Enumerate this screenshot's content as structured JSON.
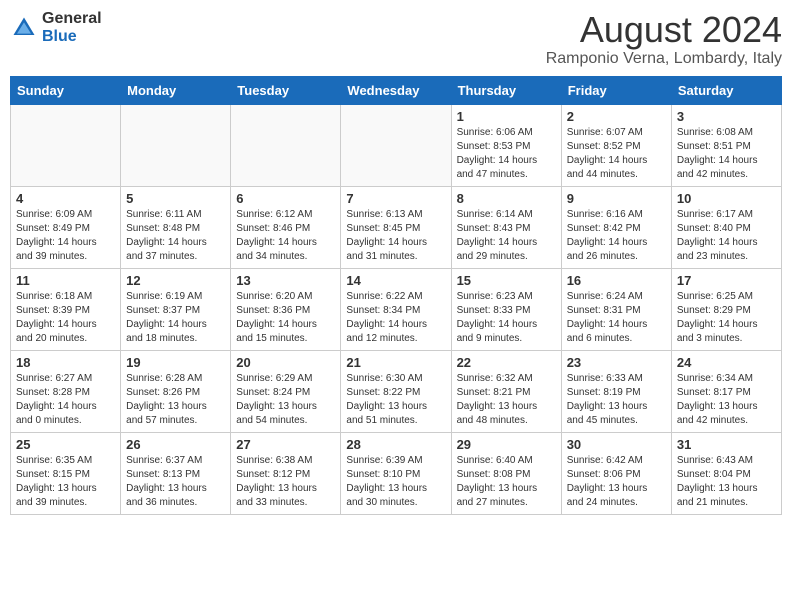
{
  "logo": {
    "general": "General",
    "blue": "Blue"
  },
  "header": {
    "month_year": "August 2024",
    "location": "Ramponio Verna, Lombardy, Italy"
  },
  "days_of_week": [
    "Sunday",
    "Monday",
    "Tuesday",
    "Wednesday",
    "Thursday",
    "Friday",
    "Saturday"
  ],
  "weeks": [
    [
      {
        "day": "",
        "info": ""
      },
      {
        "day": "",
        "info": ""
      },
      {
        "day": "",
        "info": ""
      },
      {
        "day": "",
        "info": ""
      },
      {
        "day": "1",
        "info": "Sunrise: 6:06 AM\nSunset: 8:53 PM\nDaylight: 14 hours and 47 minutes."
      },
      {
        "day": "2",
        "info": "Sunrise: 6:07 AM\nSunset: 8:52 PM\nDaylight: 14 hours and 44 minutes."
      },
      {
        "day": "3",
        "info": "Sunrise: 6:08 AM\nSunset: 8:51 PM\nDaylight: 14 hours and 42 minutes."
      }
    ],
    [
      {
        "day": "4",
        "info": "Sunrise: 6:09 AM\nSunset: 8:49 PM\nDaylight: 14 hours and 39 minutes."
      },
      {
        "day": "5",
        "info": "Sunrise: 6:11 AM\nSunset: 8:48 PM\nDaylight: 14 hours and 37 minutes."
      },
      {
        "day": "6",
        "info": "Sunrise: 6:12 AM\nSunset: 8:46 PM\nDaylight: 14 hours and 34 minutes."
      },
      {
        "day": "7",
        "info": "Sunrise: 6:13 AM\nSunset: 8:45 PM\nDaylight: 14 hours and 31 minutes."
      },
      {
        "day": "8",
        "info": "Sunrise: 6:14 AM\nSunset: 8:43 PM\nDaylight: 14 hours and 29 minutes."
      },
      {
        "day": "9",
        "info": "Sunrise: 6:16 AM\nSunset: 8:42 PM\nDaylight: 14 hours and 26 minutes."
      },
      {
        "day": "10",
        "info": "Sunrise: 6:17 AM\nSunset: 8:40 PM\nDaylight: 14 hours and 23 minutes."
      }
    ],
    [
      {
        "day": "11",
        "info": "Sunrise: 6:18 AM\nSunset: 8:39 PM\nDaylight: 14 hours and 20 minutes."
      },
      {
        "day": "12",
        "info": "Sunrise: 6:19 AM\nSunset: 8:37 PM\nDaylight: 14 hours and 18 minutes."
      },
      {
        "day": "13",
        "info": "Sunrise: 6:20 AM\nSunset: 8:36 PM\nDaylight: 14 hours and 15 minutes."
      },
      {
        "day": "14",
        "info": "Sunrise: 6:22 AM\nSunset: 8:34 PM\nDaylight: 14 hours and 12 minutes."
      },
      {
        "day": "15",
        "info": "Sunrise: 6:23 AM\nSunset: 8:33 PM\nDaylight: 14 hours and 9 minutes."
      },
      {
        "day": "16",
        "info": "Sunrise: 6:24 AM\nSunset: 8:31 PM\nDaylight: 14 hours and 6 minutes."
      },
      {
        "day": "17",
        "info": "Sunrise: 6:25 AM\nSunset: 8:29 PM\nDaylight: 14 hours and 3 minutes."
      }
    ],
    [
      {
        "day": "18",
        "info": "Sunrise: 6:27 AM\nSunset: 8:28 PM\nDaylight: 14 hours and 0 minutes."
      },
      {
        "day": "19",
        "info": "Sunrise: 6:28 AM\nSunset: 8:26 PM\nDaylight: 13 hours and 57 minutes."
      },
      {
        "day": "20",
        "info": "Sunrise: 6:29 AM\nSunset: 8:24 PM\nDaylight: 13 hours and 54 minutes."
      },
      {
        "day": "21",
        "info": "Sunrise: 6:30 AM\nSunset: 8:22 PM\nDaylight: 13 hours and 51 minutes."
      },
      {
        "day": "22",
        "info": "Sunrise: 6:32 AM\nSunset: 8:21 PM\nDaylight: 13 hours and 48 minutes."
      },
      {
        "day": "23",
        "info": "Sunrise: 6:33 AM\nSunset: 8:19 PM\nDaylight: 13 hours and 45 minutes."
      },
      {
        "day": "24",
        "info": "Sunrise: 6:34 AM\nSunset: 8:17 PM\nDaylight: 13 hours and 42 minutes."
      }
    ],
    [
      {
        "day": "25",
        "info": "Sunrise: 6:35 AM\nSunset: 8:15 PM\nDaylight: 13 hours and 39 minutes."
      },
      {
        "day": "26",
        "info": "Sunrise: 6:37 AM\nSunset: 8:13 PM\nDaylight: 13 hours and 36 minutes."
      },
      {
        "day": "27",
        "info": "Sunrise: 6:38 AM\nSunset: 8:12 PM\nDaylight: 13 hours and 33 minutes."
      },
      {
        "day": "28",
        "info": "Sunrise: 6:39 AM\nSunset: 8:10 PM\nDaylight: 13 hours and 30 minutes."
      },
      {
        "day": "29",
        "info": "Sunrise: 6:40 AM\nSunset: 8:08 PM\nDaylight: 13 hours and 27 minutes."
      },
      {
        "day": "30",
        "info": "Sunrise: 6:42 AM\nSunset: 8:06 PM\nDaylight: 13 hours and 24 minutes."
      },
      {
        "day": "31",
        "info": "Sunrise: 6:43 AM\nSunset: 8:04 PM\nDaylight: 13 hours and 21 minutes."
      }
    ]
  ]
}
